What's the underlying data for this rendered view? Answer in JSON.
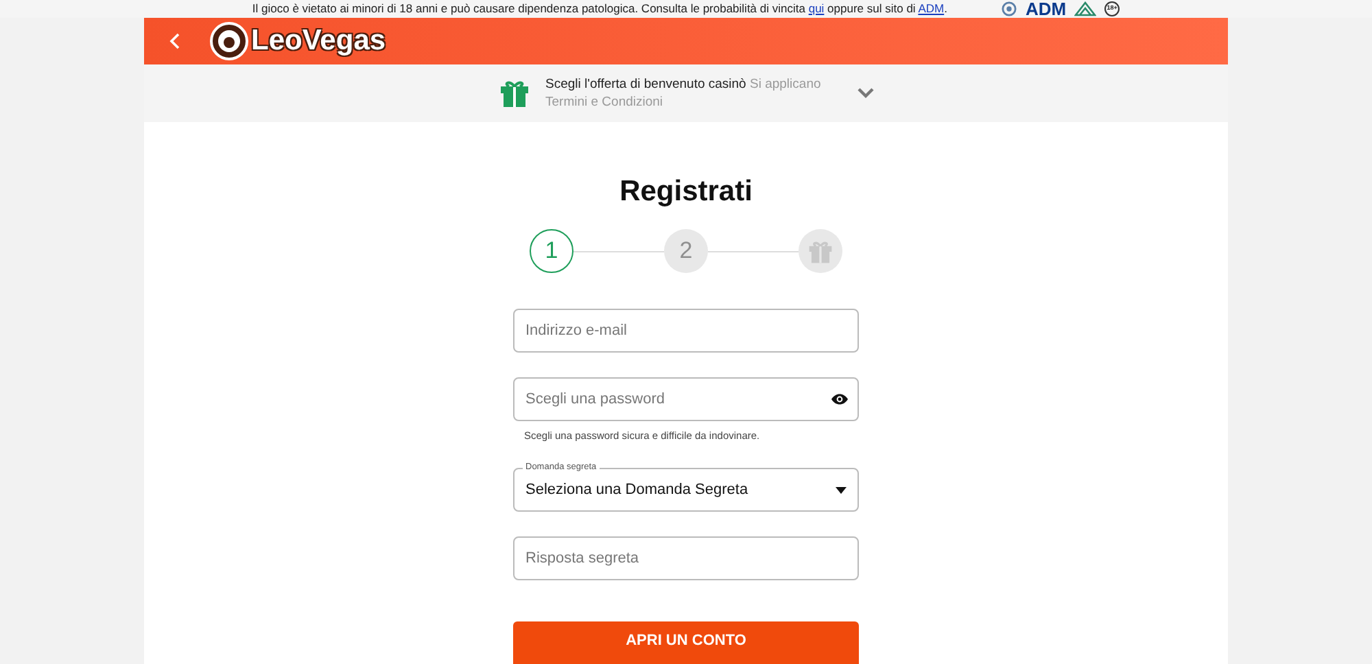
{
  "notice": {
    "before": "Il gioco è vietato ai minori di 18 anni e può causare dipendenza patologica. Consulta le probabilità di vincita ",
    "link_1": "qui",
    "middle": " oppure sul sito di ",
    "link_2": "ADM",
    "after": ".",
    "adm_logo": "ADM",
    "age_badge": "18+"
  },
  "header": {
    "logo": "LeoVegas"
  },
  "offer": {
    "title": "Scegli l'offerta di benvenuto casinò",
    "terms": "Si applicano Termini e Condizioni"
  },
  "form": {
    "title": "Registrati",
    "steps": [
      {
        "kind": "number",
        "label": "1",
        "selected": true
      },
      {
        "kind": "number",
        "label": "2",
        "selected": false
      },
      {
        "kind": "gift",
        "selected": false
      }
    ],
    "fields": [
      {
        "kind": "input",
        "placeholder": "Indirizzo e-mail"
      },
      {
        "kind": "password",
        "placeholder": "Scegli una password",
        "hint": "Scegli una password sicura e difficile da indovinare."
      },
      {
        "kind": "select",
        "label": "Domanda segreta",
        "value": "Seleziona una Domanda Segreta"
      },
      {
        "kind": "input",
        "placeholder": "Risposta segreta"
      }
    ],
    "submit": "APRI UN CONTO"
  }
}
